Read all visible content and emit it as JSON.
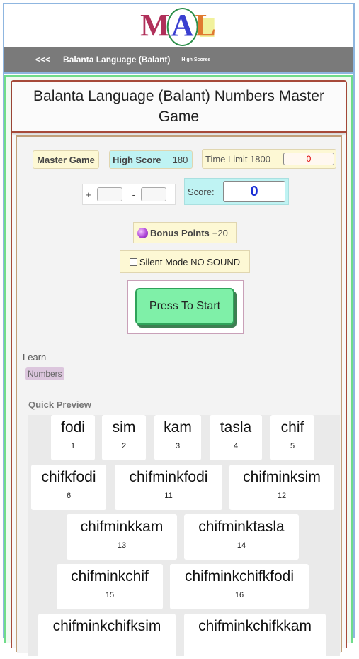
{
  "logo": {
    "text_m": "M",
    "text_a": "A",
    "text_l": "L"
  },
  "nav": {
    "back": "<<<",
    "title": "Balanta Language (Balant)",
    "high_scores": "High Scores"
  },
  "page_title": "Balanta Language (Balant) Numbers Master Game",
  "game": {
    "master_label": "Master Game",
    "high_score_label": "High Score",
    "high_score_value": "180",
    "time_limit_label": "Time Limit 1800",
    "time_value": "0",
    "plus_label": "+",
    "minus_label": "-",
    "score_label": "Score:",
    "score_value": "0",
    "bonus_label": "Bonus Points",
    "bonus_value": "+20",
    "silent_label": "Silent Mode NO SOUND",
    "start_label": "Press To Start"
  },
  "learn": {
    "label": "Learn",
    "tag": "Numbers",
    "quick_preview": "Quick Preview"
  },
  "words": [
    {
      "word": "fodi",
      "num": "1"
    },
    {
      "word": "sim",
      "num": "2"
    },
    {
      "word": "kam",
      "num": "3"
    },
    {
      "word": "tasla",
      "num": "4"
    },
    {
      "word": "chif",
      "num": "5"
    },
    {
      "word": "chifkfodi",
      "num": "6"
    },
    {
      "word": "chifminkfodi",
      "num": "11"
    },
    {
      "word": "chifminksim",
      "num": "12"
    },
    {
      "word": "chifminkkam",
      "num": "13"
    },
    {
      "word": "chifminktasla",
      "num": "14"
    },
    {
      "word": "chifminkchif",
      "num": "15"
    },
    {
      "word": "chifminkchifkfodi",
      "num": "16"
    },
    {
      "word": "chifminkchifksim",
      "num": ""
    },
    {
      "word": "chifminkchifkkam",
      "num": ""
    }
  ],
  "colors": {
    "accent_green": "#7ff0a8",
    "score_blue": "#1a2fd6",
    "timer_red": "#dd0000"
  }
}
